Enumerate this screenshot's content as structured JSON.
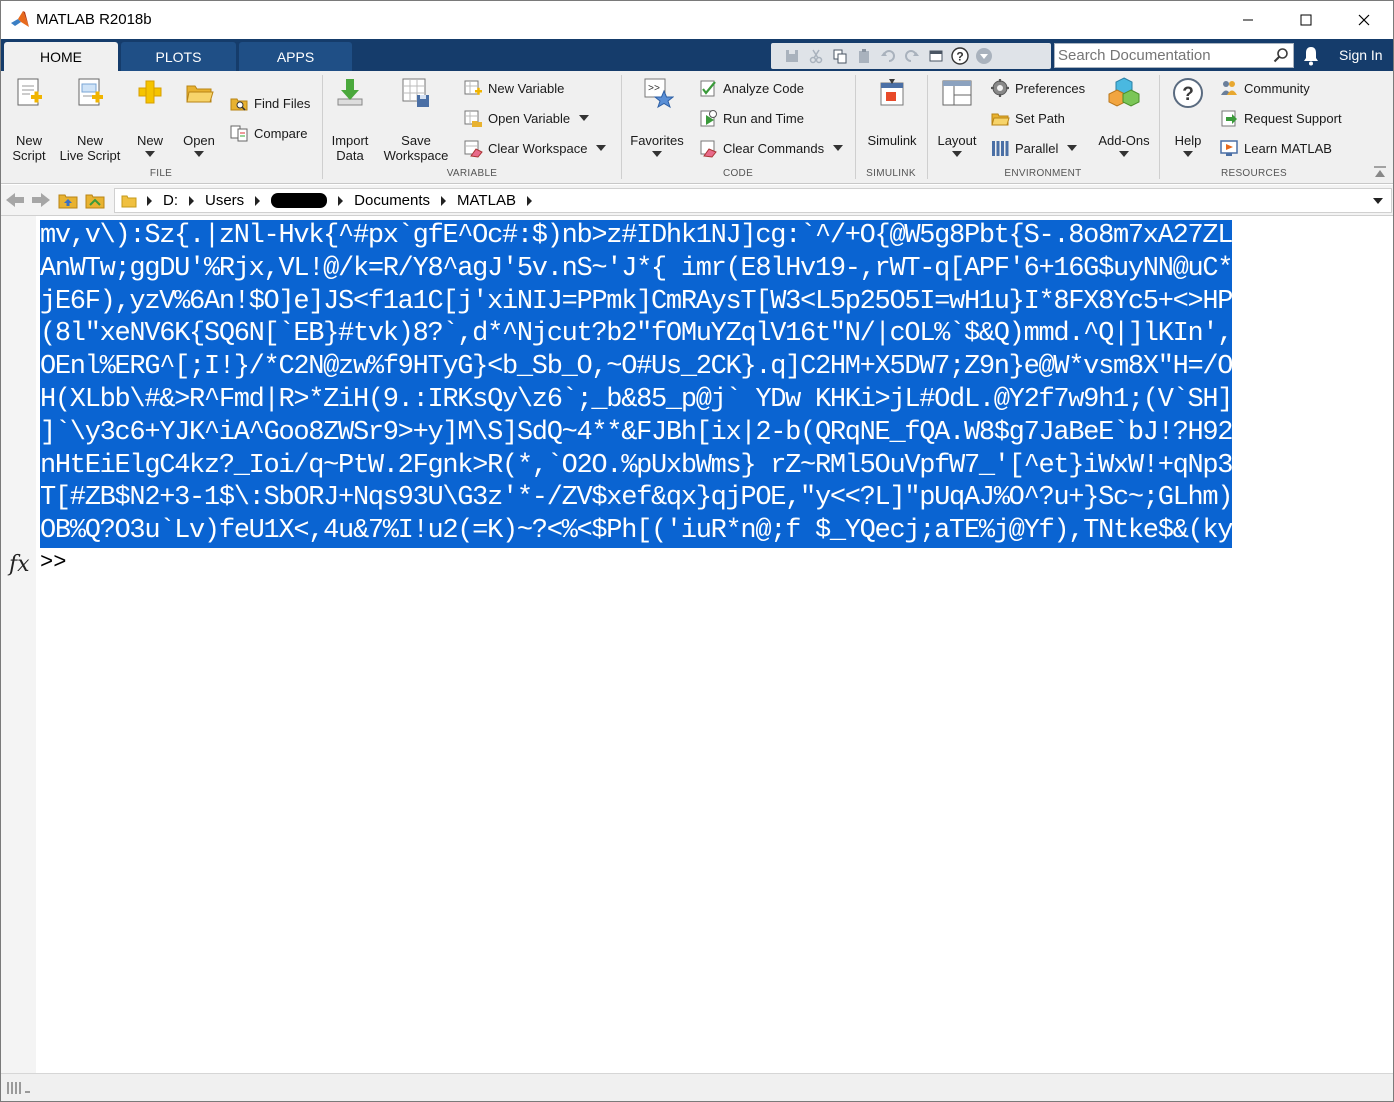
{
  "window": {
    "title": "MATLAB R2018b",
    "minimize": "—",
    "maximize": "☐",
    "close": "✕"
  },
  "tabs": [
    {
      "label": "HOME"
    },
    {
      "label": "PLOTS"
    },
    {
      "label": "APPS"
    }
  ],
  "search": {
    "placeholder": "Search Documentation"
  },
  "account": {
    "sign_in": "Sign In"
  },
  "ribbon": {
    "file": {
      "label": "FILE",
      "new_script": "New\nScript",
      "new_live_script": "New\nLive Script",
      "new": "New",
      "open": "Open",
      "find_files": "Find Files",
      "compare": "Compare"
    },
    "variable": {
      "label": "VARIABLE",
      "import_data": "Import\nData",
      "save_workspace": "Save\nWorkspace",
      "new_variable": "New Variable",
      "open_variable": "Open Variable",
      "clear_workspace": "Clear Workspace"
    },
    "code": {
      "label": "CODE",
      "favorites": "Favorites",
      "analyze_code": "Analyze Code",
      "run_and_time": "Run and Time",
      "clear_commands": "Clear Commands"
    },
    "simulink": {
      "label": "SIMULINK",
      "simulink": "Simulink"
    },
    "environment": {
      "label": "ENVIRONMENT",
      "layout": "Layout",
      "preferences": "Preferences",
      "set_path": "Set Path",
      "parallel": "Parallel",
      "add_ons": "Add-Ons"
    },
    "resources": {
      "label": "RESOURCES",
      "help": "Help",
      "community": "Community",
      "request_support": "Request Support",
      "learn_matlab": "Learn MATLAB"
    }
  },
  "address": {
    "path": [
      "D:",
      "Users",
      "Documents",
      "MATLAB"
    ]
  },
  "command_window": {
    "output_lines": [
      "mv,v\\):Sz{.|zNl-Hvk{^#px`gfE^Oc#:$)nb>z#IDhk1NJ]cg:`^/+O{@W5g8Pbt{S-.8o8m7xA27ZL",
      "AnWTw;ggDU'%Rjx,VL!@/k=R/Y8^agJ'5v.nS~'J*{ imr(E8lHv19-,rWT-q[APF'6+16G$uyNN@uC*",
      "jE6F),yzV%6An!$O]e]JS<f1a1C[j'xiNIJ=PPmk]CmRAysT[W3<L5p25O5I=wH1u}I*8FX8Yc5+<>HP",
      "(8l\"xeNV6K{SQ6N[`EB}#tvk)8?`,d*^Njcut?b2\"fOMuYZqlV16t\"N/|cOL%`$&Q)mmd.^Q|]lKIn',",
      "OEnl%ERG^[;I!}/*C2N@zw%f9HTyG}<b_Sb_O,~O#Us_2CK}.q]C2HM+X5DW7;Z9n}e@W*vsm8X\"H=/O",
      "H(XLbb\\#&>R^Fmd|R>*ZiH(9.:IRKsQy\\z6`;_b&85_p@j` YDw KHKi>jL#OdL.@Y2f7w9h1;(V`SH]",
      "]`\\y3c6+YJK^iA^Goo8ZWSr9>+y]M\\S]SdQ~4**&FJBh[ix|2-b(QRqNE_fQA.W8$g7JaBeE`bJ!?H92",
      "nHtEiElgC4kz?_Ioi/q~PtW.2Fgnk>R(*,`O2O.%pUxbWms} rZ~RMl5OuVpfW7_'[^et}iWxW!+qNp3",
      "T[#ZB$N2+3-1$\\:SbORJ+Nqs93U\\G3z'*-/ZV$xef&qx}qjPOE,\"y<<?L]\"pUqAJ%O^?u+}Sc~;GLhm)",
      "OB%Q?O3u`Lv)feU1X<,4u&7%I!u2(=K)~?<%<$Ph[('iuR*n@;f $_YQecj;aTE%j@Yf),TNtke$&(ky"
    ],
    "fx_label": "fx",
    "prompt": ">>"
  },
  "colors": {
    "tab_strip": "#153c6b",
    "selection": "#0a64d2",
    "ribbon_bg": "#f0f0f0"
  }
}
